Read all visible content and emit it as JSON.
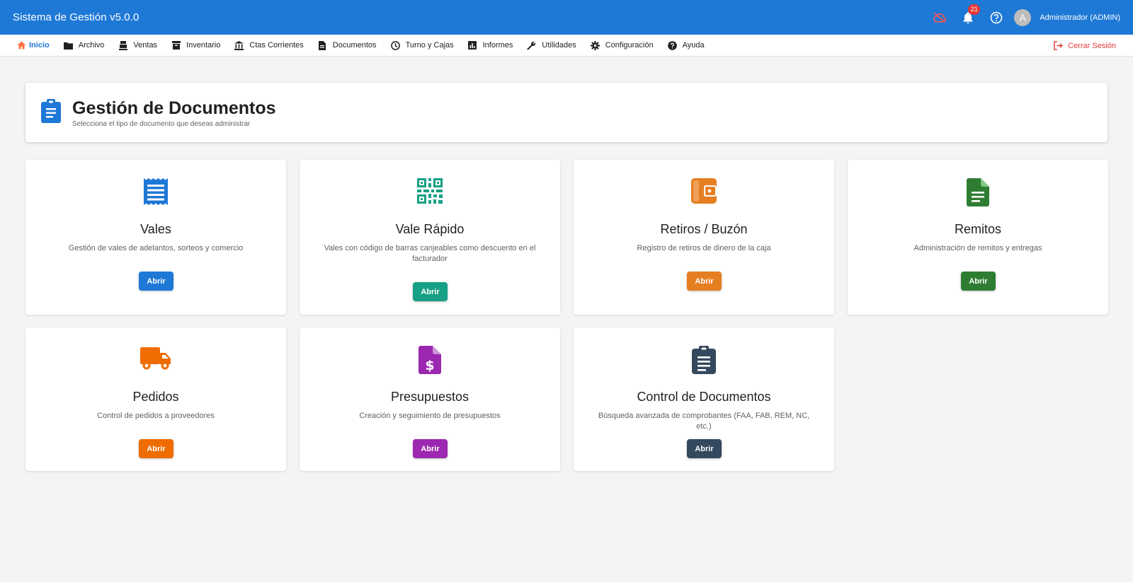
{
  "app": {
    "title": "Sistema de Gestión v5.0.0"
  },
  "topbar": {
    "cloud_icon": "cloud-off-icon",
    "notifications_count": "21",
    "avatar_letter": "A",
    "user_name": "Administrador (ADMIN)"
  },
  "nav": {
    "items": [
      {
        "label": "Inicio",
        "icon": "home-icon"
      },
      {
        "label": "Archivo",
        "icon": "folder-icon"
      },
      {
        "label": "Ventas",
        "icon": "register-icon"
      },
      {
        "label": "Inventario",
        "icon": "archive-box-icon"
      },
      {
        "label": "Ctas Corrientes",
        "icon": "bank-icon"
      },
      {
        "label": "Documentos",
        "icon": "document-icon"
      },
      {
        "label": "Turno y Cajas",
        "icon": "clock-icon"
      },
      {
        "label": "Informes",
        "icon": "bar-chart-icon"
      },
      {
        "label": "Utilidades",
        "icon": "wrench-icon"
      },
      {
        "label": "Configuración",
        "icon": "gear-icon"
      },
      {
        "label": "Ayuda",
        "icon": "help-icon"
      }
    ],
    "logout_label": "Cerrar Sesión"
  },
  "header": {
    "title": "Gestión de Documentos",
    "subtitle": "Selecciona el tipo de documento que deseas administrar"
  },
  "cards": [
    {
      "title": "Vales",
      "description": "Gestión de vales de adelantos, sorteos y comercio",
      "button": "Abrir",
      "icon": "receipt-icon",
      "color": "#1e78d6"
    },
    {
      "title": "Vale Rápido",
      "description": "Vales con código de barras canjeables como descuento en el facturador",
      "button": "Abrir",
      "icon": "qr-code-icon",
      "color": "#17a085"
    },
    {
      "title": "Retiros / Buzón",
      "description": "Registro de retiros de dinero de la caja",
      "button": "Abrir",
      "icon": "wallet-icon",
      "color": "#e67e22"
    },
    {
      "title": "Remitos",
      "description": "Administración de remitos y entregas",
      "button": "Abrir",
      "icon": "file-text-icon",
      "color": "#2e7d32"
    },
    {
      "title": "Pedidos",
      "description": "Control de pedidos a proveedores",
      "button": "Abrir",
      "icon": "truck-icon",
      "color": "#ef6c00"
    },
    {
      "title": "Presupuestos",
      "description": "Creación y seguimiento de presupuestos",
      "button": "Abrir",
      "icon": "file-dollar-icon",
      "color": "#9c27b0"
    },
    {
      "title": "Control de Documentos",
      "description": "Búsqueda avanzada de comprobantes (FAA, FAB, REM, NC, etc.)",
      "button": "Abrir",
      "icon": "clipboard-list-icon",
      "color": "#34495e"
    }
  ]
}
